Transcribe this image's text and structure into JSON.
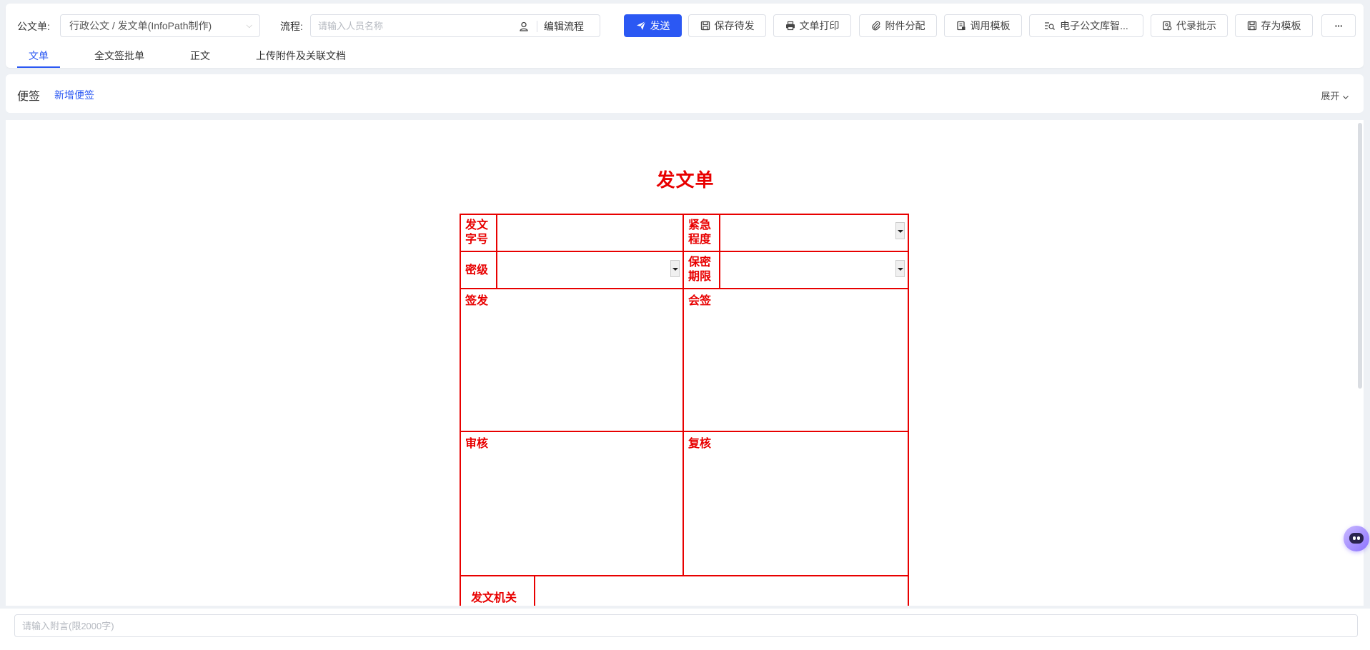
{
  "header": {
    "form_label": "公文单:",
    "form_value": "行政公文 / 发文单(InfoPath制作)",
    "flow_label": "流程:",
    "flow_placeholder": "请输入人员名称",
    "edit_flow": "编辑流程",
    "buttons": {
      "send": "发送",
      "save_pending": "保存待发",
      "print": "文单打印",
      "attach_assign": "附件分配",
      "use_template": "调用模板",
      "e_library": "电子公文库智...",
      "record_instruction": "代录批示",
      "save_template": "存为模板",
      "more": "···"
    },
    "tabs": [
      "文单",
      "全文签批单",
      "正文",
      "上传附件及关联文档"
    ]
  },
  "note_bar": {
    "title": "便签",
    "add": "新增便签",
    "expand": "展开"
  },
  "document": {
    "title": "发文单",
    "fields": {
      "doc_number": "发文\n字号",
      "urgency": "紧急\n程度",
      "secret_level": "密级",
      "secret_period": "保密\n期限",
      "sign_issue": "签发",
      "countersign": "会签",
      "review": "审核",
      "recheck": "复核",
      "issuing_org": "发文机关"
    }
  },
  "comment": {
    "placeholder": "请输入附言(限2000字)"
  },
  "colors": {
    "primary": "#2b58f3",
    "form_red": "#e80000",
    "background": "#eef1f5"
  }
}
